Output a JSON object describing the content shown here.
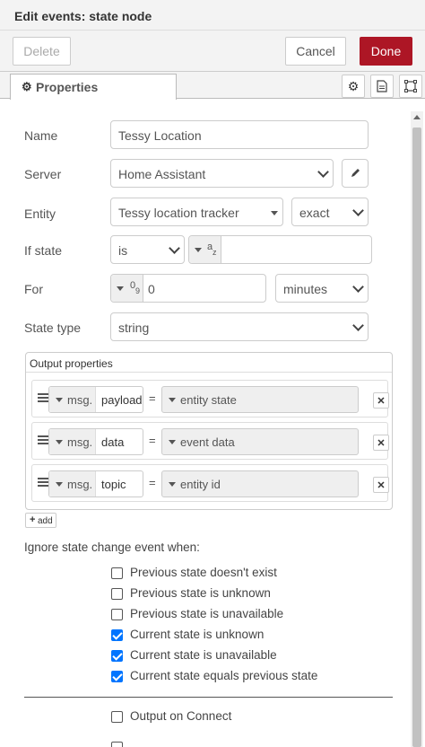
{
  "dialog": {
    "title": "Edit events: state node"
  },
  "actions": {
    "delete": "Delete",
    "cancel": "Cancel",
    "done": "Done"
  },
  "tabs": {
    "properties": "Properties"
  },
  "form": {
    "name": {
      "label": "Name",
      "value": "Tessy Location"
    },
    "server": {
      "label": "Server",
      "value": "Home Assistant"
    },
    "entity": {
      "label": "Entity",
      "value": "Tessy location tracker",
      "match": "exact"
    },
    "if_state": {
      "label": "If state",
      "operator": "is",
      "type_icon": "a",
      "type_icon_sub": "z",
      "value": ""
    },
    "for": {
      "label": "For",
      "type_icon": "0",
      "type_icon_sub": "9",
      "value": "0",
      "unit": "minutes"
    },
    "state_type": {
      "label": "State type",
      "value": "string"
    }
  },
  "output_properties": {
    "header": "Output properties",
    "rows": [
      {
        "prefix": "msg.",
        "property": "payload",
        "eq": "=",
        "value": "entity state"
      },
      {
        "prefix": "msg.",
        "property": "data",
        "eq": "=",
        "value": "event data"
      },
      {
        "prefix": "msg.",
        "property": "topic",
        "eq": "=",
        "value": "entity id"
      }
    ],
    "add": "add"
  },
  "ignore": {
    "heading": "Ignore state change event when:",
    "options": [
      {
        "label": "Previous state doesn't exist",
        "checked": false
      },
      {
        "label": "Previous state is unknown",
        "checked": false
      },
      {
        "label": "Previous state is unavailable",
        "checked": false
      },
      {
        "label": "Current state is unknown",
        "checked": true
      },
      {
        "label": "Current state is unavailable",
        "checked": true
      },
      {
        "label": "Current state equals previous state",
        "checked": true
      }
    ]
  },
  "output_on_connect": {
    "label": "Output on Connect",
    "checked": false
  },
  "colors": {
    "done": "#ad1625",
    "checkbox": "#0075ff"
  }
}
